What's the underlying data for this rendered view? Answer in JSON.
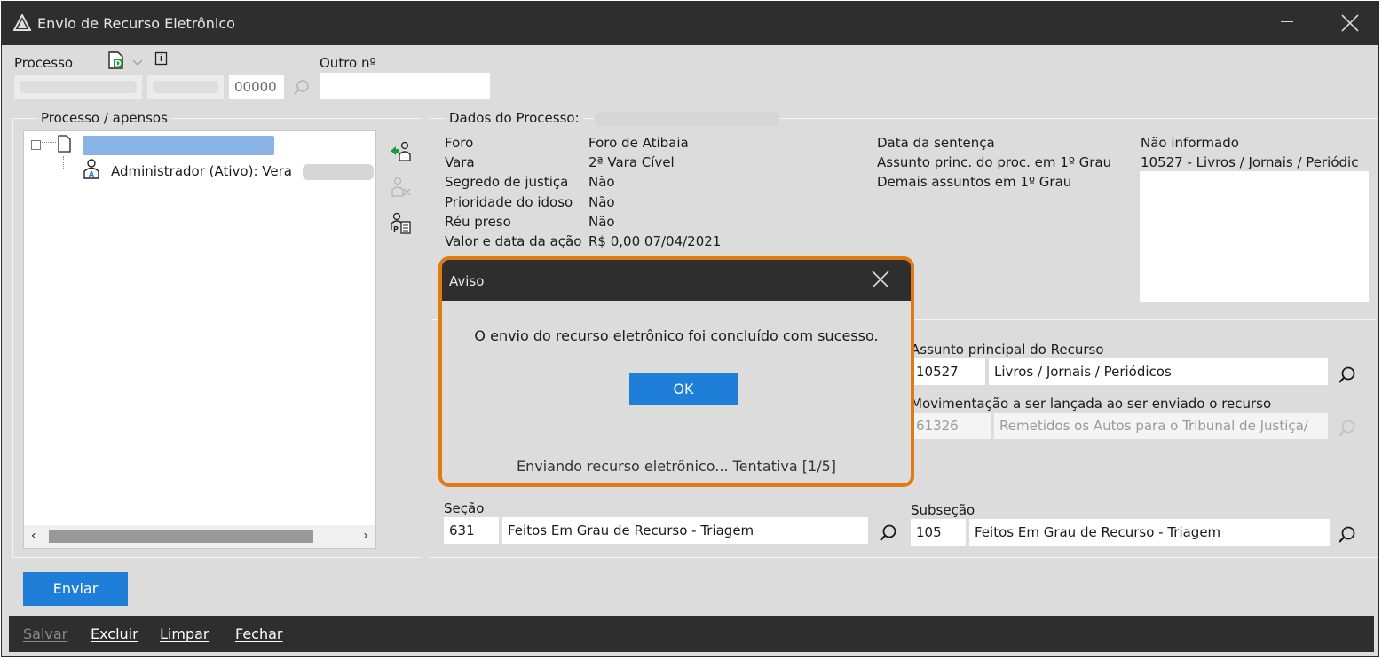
{
  "window": {
    "title": "Envio de Recurso Eletrônico"
  },
  "processo": {
    "label": "Processo",
    "field3_value": "00000",
    "outro_label": "Outro nº",
    "outro_value": ""
  },
  "tree_panel": {
    "legend": "Processo / apensos",
    "child_label": "Administrador (Ativo): Vera"
  },
  "dados": {
    "legend": "Dados do Processo:",
    "rows": [
      {
        "label": "Foro",
        "value": "Foro de Atibaia"
      },
      {
        "label": "Vara",
        "value": "2ª Vara Cível"
      },
      {
        "label": "Segredo de justiça",
        "value": "Não"
      },
      {
        "label": "Prioridade do idoso",
        "value": "Não"
      },
      {
        "label": "Réu preso",
        "value": "Não"
      },
      {
        "label": "Valor e data da ação",
        "value": "R$ 0,00 07/04/2021"
      }
    ],
    "right_labels": [
      "Data da sentença",
      "Assunto princ. do proc. em 1º Grau",
      "Demais assuntos em 1º Grau"
    ],
    "right_values": [
      "Não informado",
      "10527 - Livros / Jornais / Periódic"
    ]
  },
  "recurso": {
    "assunto_label": "Assunto principal do Recurso",
    "assunto_code": "10527",
    "assunto_desc": "Livros / Jornais / Periódicos",
    "mov_label": "Movimentação a ser lançada ao ser enviado o recurso",
    "mov_code": "61326",
    "mov_desc": "Remetidos os Autos para o Tribunal de Justiça/"
  },
  "secao": {
    "label": "Seção",
    "code": "631",
    "desc": "Feitos Em Grau de Recurso - Triagem"
  },
  "subsecao": {
    "label": "Subseção",
    "code": "105",
    "desc": "Feitos Em Grau de Recurso - Triagem"
  },
  "buttons": {
    "enviar": "Enviar"
  },
  "bottom_menu": {
    "salvar": "Salvar",
    "excluir": "Excluir",
    "limpar": "Limpar",
    "fechar": "Fechar"
  },
  "dialog": {
    "title": "Aviso",
    "message": "O envio do recurso eletrônico foi concluído com sucesso.",
    "ok": "OK",
    "status": "Enviando recurso eletrônico... Tentativa [1/5]"
  },
  "colors": {
    "accent": "#1e7ed8",
    "highlight_border": "#e07b14",
    "titlebar": "#2e2e2e"
  }
}
